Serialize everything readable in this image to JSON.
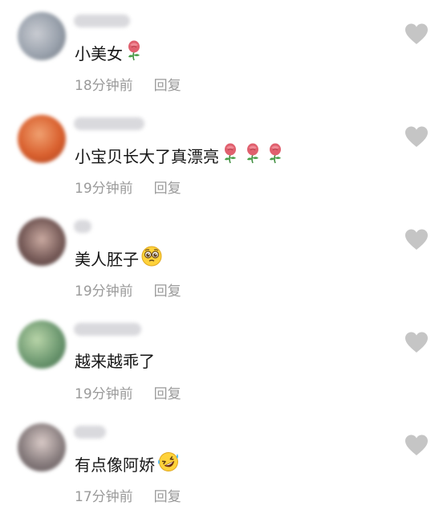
{
  "comments": [
    {
      "text": "小美女",
      "time": "18分钟前",
      "reply_label": "回复",
      "emojis": [
        "rose-icon"
      ],
      "avatar_color": "#9aa2ad",
      "name_width": 70
    },
    {
      "text": "小宝贝长大了真漂亮",
      "time": "19分钟前",
      "reply_label": "回复",
      "emojis": [
        "rose-icon",
        "rose-icon",
        "rose-icon"
      ],
      "avatar_color": "#d9602e",
      "name_width": 88
    },
    {
      "text": "美人胚子",
      "time": "19分钟前",
      "reply_label": "回复",
      "emojis": [
        "pleading-face-icon"
      ],
      "avatar_color": "#7a5e5b",
      "name_width": 22
    },
    {
      "text": "越来越乖了",
      "time": "19分钟前",
      "reply_label": "回复",
      "emojis": [],
      "avatar_color": "#6f9a72",
      "name_width": 84
    },
    {
      "text": "有点像阿娇",
      "time": "17分钟前",
      "reply_label": "回复",
      "emojis": [
        "rolling-laughing-icon"
      ],
      "avatar_color": "#8a7f80",
      "name_width": 40
    }
  ]
}
